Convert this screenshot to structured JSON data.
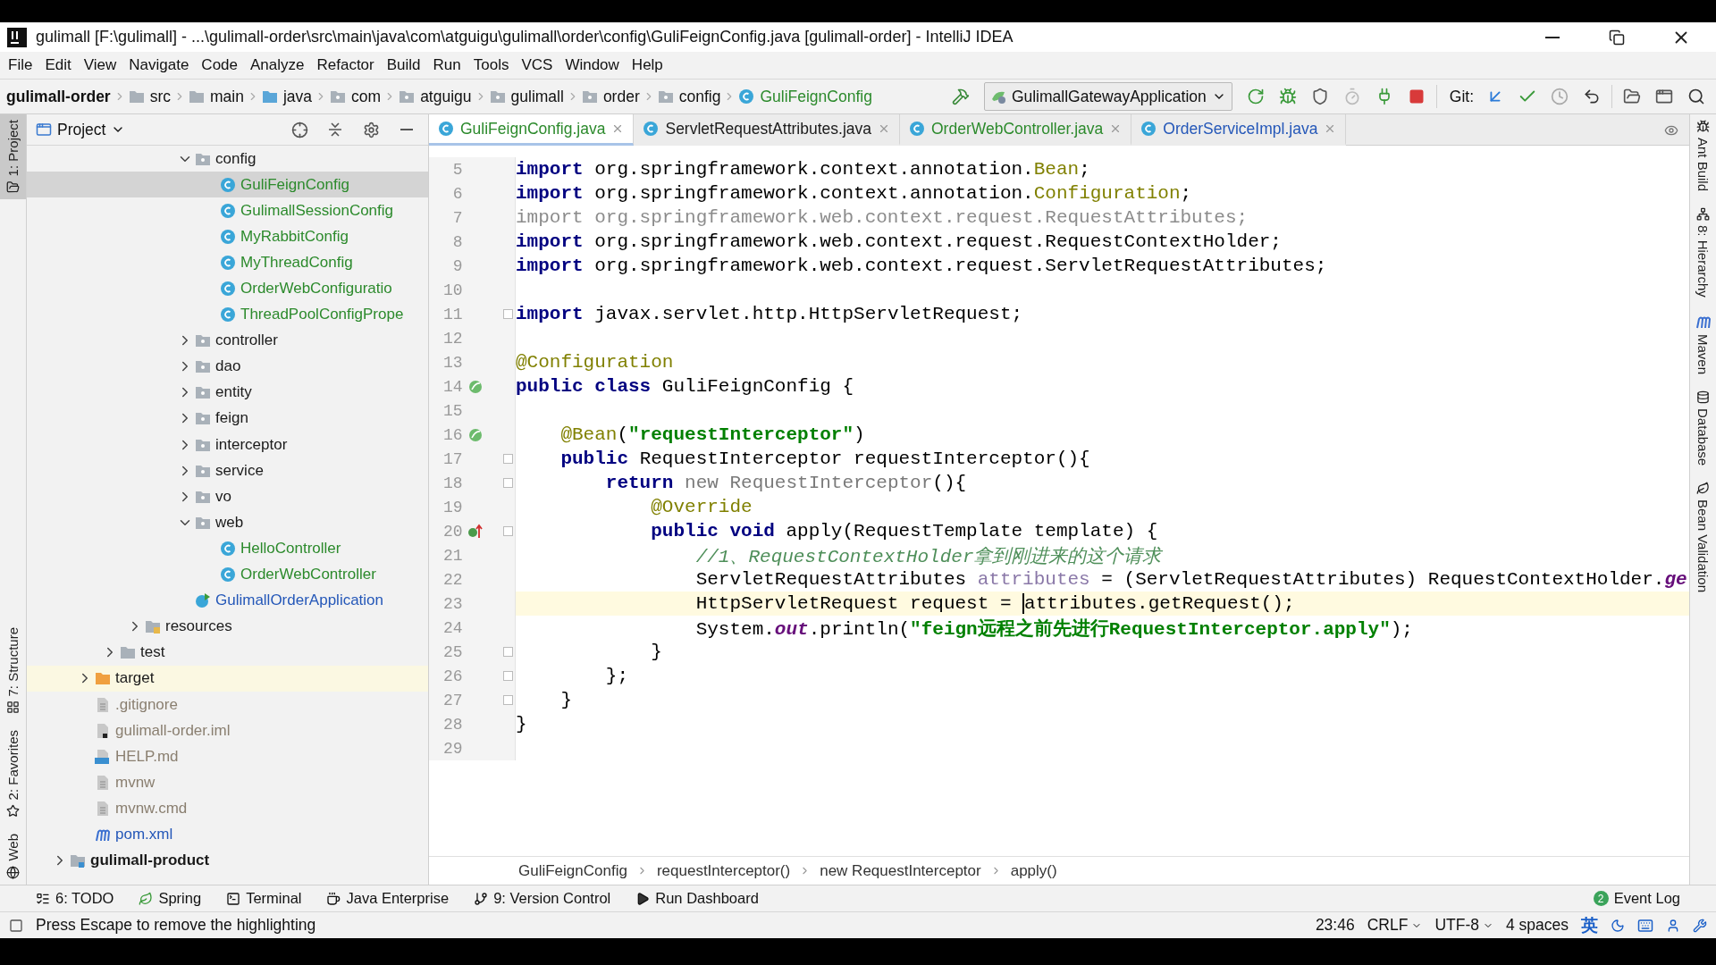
{
  "window": {
    "title": "gulimall [F:\\gulimall] - ...\\gulimall-order\\src\\main\\java\\com\\atguigu\\gulimall\\order\\config\\GuliFeignConfig.java [gulimall-order] - IntelliJ IDEA"
  },
  "menu": [
    "File",
    "Edit",
    "View",
    "Navigate",
    "Code",
    "Analyze",
    "Refactor",
    "Build",
    "Run",
    "Tools",
    "VCS",
    "Window",
    "Help"
  ],
  "nav_bar": {
    "crumbs": [
      {
        "label": "gulimall-order",
        "kind": "module"
      },
      {
        "label": "src",
        "kind": "folder"
      },
      {
        "label": "main",
        "kind": "folder"
      },
      {
        "label": "java",
        "kind": "source-folder"
      },
      {
        "label": "com",
        "kind": "package"
      },
      {
        "label": "atguigu",
        "kind": "package"
      },
      {
        "label": "gulimall",
        "kind": "package"
      },
      {
        "label": "order",
        "kind": "package"
      },
      {
        "label": "config",
        "kind": "package"
      },
      {
        "label": "GuliFeignConfig",
        "kind": "class"
      }
    ],
    "run_config": "GulimallGatewayApplication",
    "git_label": "Git:"
  },
  "left_strip": [
    {
      "label": "1: Project",
      "selected": true,
      "kind": "project"
    },
    {
      "label": "7: Structure",
      "selected": false,
      "kind": "structure"
    },
    {
      "label": "2: Favorites",
      "selected": false,
      "kind": "favorites"
    },
    {
      "label": "Web",
      "selected": false,
      "kind": "web"
    }
  ],
  "right_strip": [
    {
      "label": "Ant Build",
      "kind": "ant"
    },
    {
      "label": "8: Hierarchy",
      "kind": "hierarchy"
    },
    {
      "label": "Maven",
      "kind": "maven"
    },
    {
      "label": "Database",
      "kind": "database"
    },
    {
      "label": "Bean Validation",
      "kind": "bean"
    }
  ],
  "project_panel": {
    "title": "Project",
    "tree": [
      {
        "children": [
          {
            "children": [
              {
                "children": [
                  {
                    "children": [
                      {
                        "children": [
                          {
                            "label": "config",
                            "kind": "package",
                            "expanded": true,
                            "selected": false,
                            "children": [
                              {
                                "label": "GuliFeignConfig",
                                "kind": "class",
                                "color": "#2c8a2c",
                                "selected": true
                              },
                              {
                                "label": "GulimallSessionConfig",
                                "kind": "class",
                                "color": "#2c8a2c",
                                "selected": false
                              },
                              {
                                "label": "MyRabbitConfig",
                                "kind": "class",
                                "color": "#2c8a2c",
                                "selected": false
                              },
                              {
                                "label": "MyThreadConfig",
                                "kind": "class",
                                "color": "#2c8a2c",
                                "selected": false
                              },
                              {
                                "label": "OrderWebConfiguratio",
                                "kind": "class",
                                "color": "#2c8a2c",
                                "selected": false
                              },
                              {
                                "label": "ThreadPoolConfigPrope",
                                "kind": "class",
                                "color": "#2c8a2c",
                                "selected": false
                              }
                            ]
                          },
                          {
                            "label": "controller",
                            "kind": "package",
                            "expanded": false,
                            "selected": false
                          },
                          {
                            "label": "dao",
                            "kind": "package",
                            "expanded": false,
                            "selected": false
                          },
                          {
                            "label": "entity",
                            "kind": "package",
                            "expanded": false,
                            "selected": false
                          },
                          {
                            "label": "feign",
                            "kind": "package",
                            "expanded": false,
                            "selected": false
                          },
                          {
                            "label": "interceptor",
                            "kind": "package",
                            "expanded": false,
                            "selected": false
                          },
                          {
                            "label": "service",
                            "kind": "package",
                            "expanded": false,
                            "selected": false
                          },
                          {
                            "label": "vo",
                            "kind": "package",
                            "expanded": false,
                            "selected": false
                          },
                          {
                            "label": "web",
                            "kind": "package",
                            "expanded": true,
                            "selected": false,
                            "children": [
                              {
                                "label": "HelloController",
                                "kind": "class",
                                "color": "#2c8a2c",
                                "selected": false
                              },
                              {
                                "label": "OrderWebController",
                                "kind": "class",
                                "color": "#2c8a2c",
                                "selected": false
                              }
                            ]
                          },
                          {
                            "label": "GulimallOrderApplication",
                            "kind": "app",
                            "color": "#2457b8",
                            "selected": false
                          }
                        ]
                      }
                    ]
                  },
                  {
                    "label": "resources",
                    "kind": "resources",
                    "expanded": false,
                    "selected": false
                  }
                ]
              },
              {
                "label": "test",
                "kind": "folder",
                "expanded": false,
                "selected": false
              }
            ]
          },
          {
            "label": "target",
            "kind": "excluded",
            "expanded": false,
            "selected": false
          },
          {
            "label": ".gitignore",
            "kind": "file",
            "color": "#8a7f70",
            "selected": false
          },
          {
            "label": "gulimall-order.iml",
            "kind": "iml",
            "color": "#8a7f70",
            "selected": false
          },
          {
            "label": "HELP.md",
            "kind": "md",
            "color": "#8a7f70",
            "selected": false
          },
          {
            "label": "mvnw",
            "kind": "file",
            "color": "#8a7f70",
            "selected": false
          },
          {
            "label": "mvnw.cmd",
            "kind": "file",
            "color": "#8a7f70",
            "selected": false
          },
          {
            "label": "pom.xml",
            "kind": "maven",
            "color": "#2457b8",
            "selected": false
          }
        ]
      },
      {
        "label": "gulimall-product",
        "kind": "module",
        "expanded": false,
        "selected": false
      }
    ]
  },
  "tabs": [
    {
      "label": "GuliFeignConfig.java",
      "selected": true,
      "color": "#2c8a2c"
    },
    {
      "label": "ServletRequestAttributes.java",
      "selected": false
    },
    {
      "label": "OrderWebController.java",
      "selected": false,
      "color": "#2c8a2c"
    },
    {
      "label": "OrderServiceImpl.java",
      "selected": false,
      "color": "#2457b8"
    }
  ],
  "editor": {
    "lines": [
      {
        "number": "5",
        "tokens": [
          {
            "kind": "kw",
            "text": "import"
          },
          {
            "kind": "plain",
            "text": " org.springframework.context.annotation."
          },
          {
            "kind": "ann",
            "text": "Bean"
          },
          {
            "kind": "plain",
            "text": ";"
          }
        ]
      },
      {
        "number": "6",
        "tokens": [
          {
            "kind": "kw",
            "text": "import"
          },
          {
            "kind": "plain",
            "text": " org.springframework.context.annotation."
          },
          {
            "kind": "ann",
            "text": "Configuration"
          },
          {
            "kind": "plain",
            "text": ";"
          }
        ]
      },
      {
        "number": "7",
        "tokens": [
          {
            "kind": "unused",
            "text": "import org.springframework.web.context.request.RequestAttributes;"
          }
        ]
      },
      {
        "number": "8",
        "tokens": [
          {
            "kind": "kw",
            "text": "import"
          },
          {
            "kind": "plain",
            "text": " org.springframework.web.context.request.RequestContextHolder;"
          }
        ]
      },
      {
        "number": "9",
        "tokens": [
          {
            "kind": "kw",
            "text": "import"
          },
          {
            "kind": "plain",
            "text": " org.springframework.web.context.request.ServletRequestAttributes;"
          }
        ]
      },
      {
        "number": "10"
      },
      {
        "number": "11",
        "fold": true,
        "tokens": [
          {
            "kind": "kw",
            "text": "import"
          },
          {
            "kind": "plain",
            "text": " javax.servlet.http.HttpServletRequest;"
          }
        ]
      },
      {
        "number": "12"
      },
      {
        "number": "13",
        "tokens": [
          {
            "kind": "ann",
            "text": "@Configuration"
          }
        ]
      },
      {
        "number": "14",
        "gutter_icon": {
          "kind": "bean"
        },
        "tokens": [
          {
            "kind": "kw",
            "text": "public class"
          },
          {
            "kind": "plain",
            "text": " GuliFeignConfig {"
          }
        ]
      },
      {
        "number": "15"
      },
      {
        "number": "16",
        "gutter_icon": {
          "kind": "bean"
        },
        "tokens": [
          {
            "kind": "ann",
            "text": "    @Bean"
          },
          {
            "kind": "plain",
            "text": "("
          },
          {
            "kind": "str",
            "text": "\"requestInterceptor\""
          },
          {
            "kind": "plain",
            "text": ")"
          }
        ]
      },
      {
        "number": "17",
        "fold": true,
        "tokens": [
          {
            "kind": "kw",
            "text": "    public"
          },
          {
            "kind": "plain",
            "text": " RequestInterceptor requestInterceptor(){"
          }
        ]
      },
      {
        "number": "18",
        "fold": true,
        "tokens": [
          {
            "kind": "kw",
            "text": "        return"
          },
          {
            "kind": "dim",
            "text": " new RequestInterceptor"
          },
          {
            "kind": "plain",
            "text": "(){"
          }
        ]
      },
      {
        "number": "19",
        "tokens": [
          {
            "kind": "ann",
            "text": "            @Override"
          }
        ]
      },
      {
        "number": "20",
        "gutter_icon": {
          "kind": "override"
        },
        "fold": true,
        "tokens": [
          {
            "kind": "kw",
            "text": "            public void"
          },
          {
            "kind": "plain",
            "text": " apply(RequestTemplate template) {"
          }
        ]
      },
      {
        "number": "21",
        "tokens": [
          {
            "kind": "comment",
            "text": "                //1、RequestContextHolder拿到刚进来的这个请求"
          }
        ]
      },
      {
        "number": "22",
        "tokens": [
          {
            "kind": "plain",
            "text": "                ServletRequestAttributes "
          },
          {
            "kind": "field",
            "text": "attributes"
          },
          {
            "kind": "plain",
            "text": " = (ServletRequestAttributes) RequestContextHolder."
          },
          {
            "kind": "static",
            "text": "ge"
          }
        ]
      },
      {
        "number": "23",
        "current": true,
        "tokens": [
          {
            "kind": "plain",
            "text": "                HttpServletRequest request = "
          },
          {
            "kind": "plain",
            "text": "attributes.getRequest();",
            "caret": true
          }
        ]
      },
      {
        "number": "24",
        "tokens": [
          {
            "kind": "plain",
            "text": "                System."
          },
          {
            "kind": "static",
            "text": "out"
          },
          {
            "kind": "plain",
            "text": ".println("
          },
          {
            "kind": "str",
            "text": "\"feign远程之前先进行RequestInterceptor.apply\""
          },
          {
            "kind": "plain",
            "text": ");"
          }
        ]
      },
      {
        "number": "25",
        "fold": true,
        "tokens": [
          {
            "kind": "plain",
            "text": "            }"
          }
        ]
      },
      {
        "number": "26",
        "fold": true,
        "tokens": [
          {
            "kind": "plain",
            "text": "        };"
          }
        ]
      },
      {
        "number": "27",
        "fold": true,
        "tokens": [
          {
            "kind": "plain",
            "text": "    }"
          }
        ]
      },
      {
        "number": "28",
        "tokens": [
          {
            "kind": "plain",
            "text": "}"
          }
        ]
      },
      {
        "number": "29"
      }
    ],
    "breadcrumbs": [
      "GuliFeignConfig",
      "requestInterceptor()",
      "new RequestInterceptor",
      "apply()"
    ]
  },
  "tool_windows": [
    {
      "label": "6: TODO",
      "kind": "todo"
    },
    {
      "label": "Spring",
      "kind": "spring"
    },
    {
      "label": "Terminal",
      "kind": "terminal"
    },
    {
      "label": "Java Enterprise",
      "kind": "javaee"
    },
    {
      "label": "9: Version Control",
      "kind": "vcs"
    },
    {
      "label": "Run Dashboard",
      "kind": "run"
    }
  ],
  "event_log": {
    "label": "Event Log",
    "badge": "2"
  },
  "status_bar": {
    "message": "Press Escape to remove the highlighting",
    "position": "23:46",
    "line_separator": "CRLF",
    "encoding": "UTF-8",
    "indent": "4 spaces",
    "ime": "英"
  }
}
